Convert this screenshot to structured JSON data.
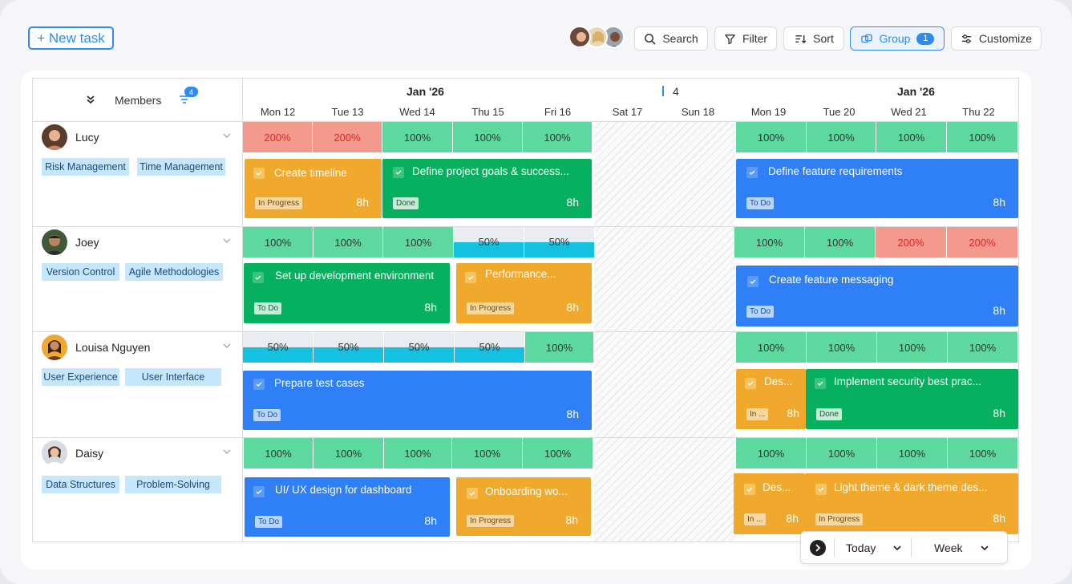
{
  "toolbar": {
    "new_task": "+ New task",
    "search": "Search",
    "filter": "Filter",
    "sort": "Sort",
    "group": "Group",
    "group_count": "1",
    "customize": "Customize"
  },
  "header": {
    "members_label": "Members",
    "filter_count": "4",
    "month_left": "Jan '26",
    "week_number": "4",
    "month_right": "Jan '26",
    "days": [
      "Mon 12",
      "Tue 13",
      "Wed 14",
      "Thu 15",
      "Fri 16",
      "Sat 17",
      "Sun 18",
      "Mon 19",
      "Tue 20",
      "Wed 21",
      "Thu 22"
    ]
  },
  "members": [
    {
      "name": "Lucy",
      "skills": [
        "Risk Management",
        "Time Management"
      ],
      "allocation": [
        "200%",
        "200%",
        "100%",
        "100%",
        "100%",
        "",
        "",
        "100%",
        "100%",
        "100%",
        "100%"
      ],
      "tasks": [
        {
          "title": "Create timeline",
          "status": "In Progress",
          "hours": "8h"
        },
        {
          "title": "Define project goals & success...",
          "status": "Done",
          "hours": "8h"
        },
        {
          "title": "Define feature requirements",
          "status": "To Do",
          "hours": "8h"
        }
      ]
    },
    {
      "name": "Joey",
      "skills": [
        "Version Control",
        "Agile Methodologies"
      ],
      "allocation": [
        "100%",
        "100%",
        "100%",
        "50%",
        "50%",
        "",
        "",
        "100%",
        "100%",
        "200%",
        "200%"
      ],
      "tasks": [
        {
          "title": "Set up development environment",
          "status": "To Do",
          "hours": "8h"
        },
        {
          "title": "Performance...",
          "status": "In Progress",
          "hours": "8h"
        },
        {
          "title": "Create feature messaging",
          "status": "To Do",
          "hours": "8h"
        }
      ]
    },
    {
      "name": "Louisa Nguyen",
      "skills": [
        "User Experience",
        "User Interface"
      ],
      "allocation": [
        "50%",
        "50%",
        "50%",
        "50%",
        "100%",
        "",
        "",
        "100%",
        "100%",
        "100%",
        "100%"
      ],
      "tasks": [
        {
          "title": "Prepare test cases",
          "status": "To Do",
          "hours": "8h"
        },
        {
          "title": "Des...",
          "status": "In ...",
          "hours": "8h"
        },
        {
          "title": "Implement security best prac...",
          "status": "Done",
          "hours": "8h"
        }
      ]
    },
    {
      "name": "Daisy",
      "skills": [
        "Data Structures",
        "Problem-Solving"
      ],
      "allocation": [
        "100%",
        "100%",
        "100%",
        "100%",
        "100%",
        "",
        "",
        "100%",
        "100%",
        "100%",
        "100%"
      ],
      "tasks": [
        {
          "title": "UI/ UX design for dashboard",
          "status": "To Do",
          "hours": "8h"
        },
        {
          "title": "Onboarding wo...",
          "status": "In Progress",
          "hours": "8h"
        },
        {
          "title": "Des...",
          "status": "In ...",
          "hours": "8h"
        },
        {
          "title": "Light theme & dark theme des...",
          "status": "In Progress",
          "hours": "8h"
        }
      ]
    }
  ],
  "footer": {
    "today": "Today",
    "view": "Week"
  },
  "colors": {
    "accent": "#2f8bf0",
    "alloc_100": "#5dd9a0",
    "alloc_200": "#f3998d",
    "alloc_50": "#14c1e0",
    "task_in_progress": "#f0a92c",
    "task_done": "#06b05e",
    "task_todo": "#2f7ff6"
  }
}
